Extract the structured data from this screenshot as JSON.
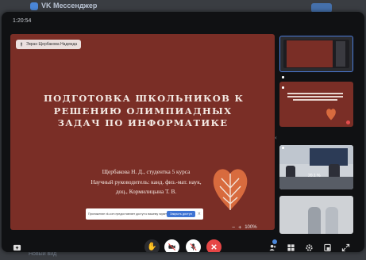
{
  "background_app": {
    "title": "VK Мессенджер",
    "bottom_text": "Новый вид"
  },
  "call": {
    "timer": "1:20:54",
    "presenter": "Экран Щербакова Надежда",
    "zoom": "100%"
  },
  "slide": {
    "title_lines": [
      "ПОДГОТОВКА ШКОЛЬНИКОВ К",
      "РЕШЕНИЮ ОЛИМПИАДНЫХ",
      "ЗАДАЧ ПО ИНФОРМАТИКЕ"
    ],
    "author_lines": [
      "Щербакова Н. Д., студентка 5 курса",
      "Научный руководитель: канд. физ.-мат. наук,",
      "доц., Кормилицына Т. В."
    ]
  },
  "notice": {
    "text": "Приложение vk.com предоставляет доступ к вашему экрану.",
    "button": "Закрыть доступ",
    "close": "×"
  },
  "thumbnails": {
    "t3_percent": "20.1 %"
  },
  "colors": {
    "slide_bg": "#7a2e26",
    "end_call": "#e64646",
    "accent": "#4a86d8"
  },
  "icons": [
    "screen-share-icon",
    "raise-hand-icon",
    "camera-off-icon",
    "mic-off-icon",
    "end-call-icon",
    "participants-icon",
    "grid-icon",
    "settings-icon",
    "pip-icon",
    "fullscreen-icon"
  ]
}
